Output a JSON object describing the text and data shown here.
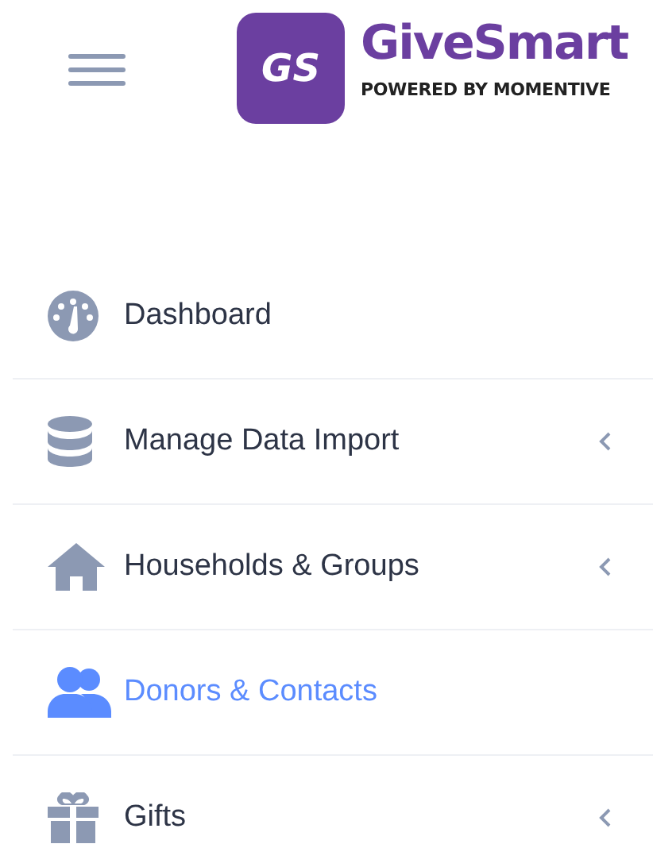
{
  "header": {
    "logo_mark": "GS",
    "brand": "GiveSmart",
    "tagline": "POWERED BY MOMENTIVE"
  },
  "nav": [
    {
      "label": "Dashboard",
      "selected": false,
      "has_submenu": false
    },
    {
      "label": "Manage Data Import",
      "selected": false,
      "has_submenu": true
    },
    {
      "label": "Households & Groups",
      "selected": false,
      "has_submenu": true
    },
    {
      "label": "Donors & Contacts",
      "selected": true,
      "has_submenu": false
    },
    {
      "label": "Gifts",
      "selected": false,
      "has_submenu": true
    }
  ]
}
